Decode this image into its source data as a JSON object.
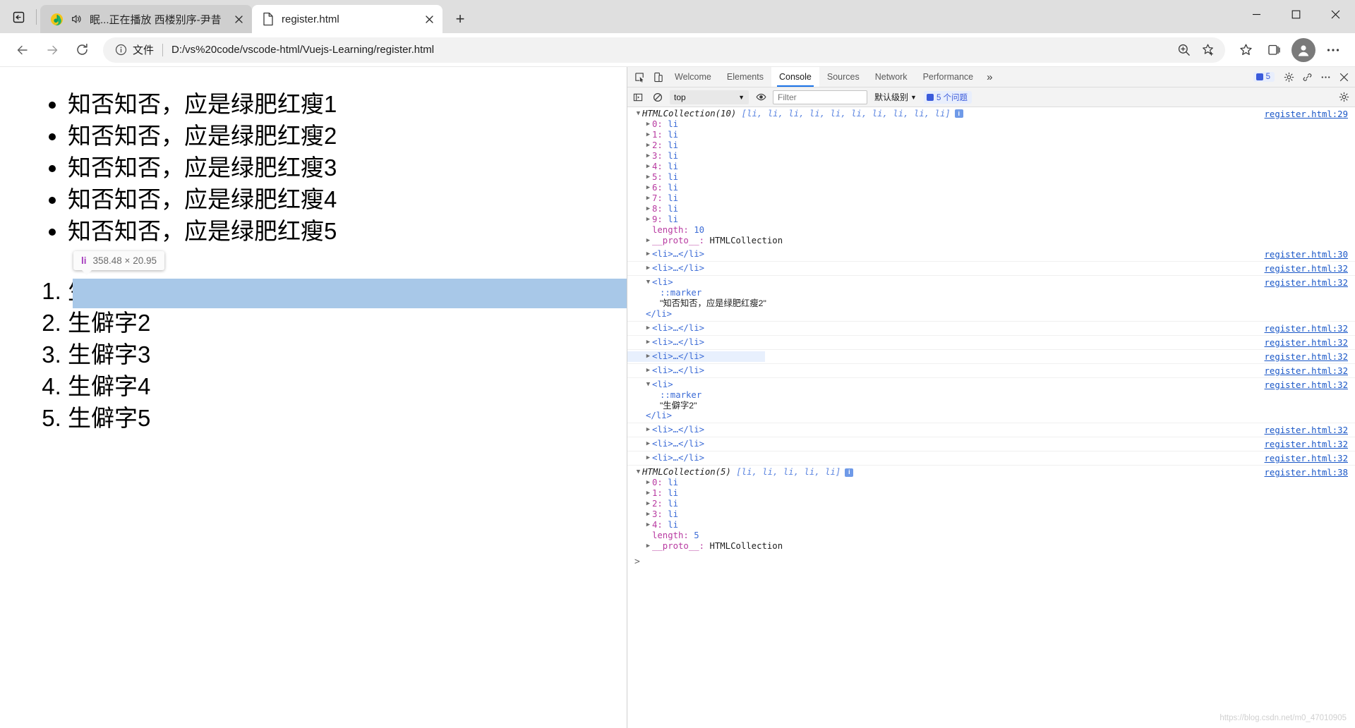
{
  "browser": {
    "tabs": [
      {
        "title": "眠...正在播放 西楼别序-尹昔",
        "favicon": "music-note-icon",
        "active": false
      },
      {
        "title": "register.html",
        "favicon": "document-icon",
        "active": true
      }
    ],
    "newtab_label": "+",
    "window_controls": {
      "minimize": "–",
      "maximize": "▢",
      "close": "✕"
    },
    "omnibox": {
      "scheme_label": "文件",
      "url": "D:/vs%20code/vscode-html/Vuejs-Learning/register.html",
      "info_icon": "info-icon",
      "zoom_icon": "zoom-in-icon",
      "favorite_icon": "star-plus-icon"
    },
    "toolbar": {
      "back": "back-arrow-icon",
      "forward": "forward-arrow-icon",
      "reload": "reload-icon",
      "collections": "collections-icon",
      "favorites": "favorites-icon",
      "profile": "profile-avatar-icon",
      "settings": "more-options-icon"
    }
  },
  "page": {
    "unordered_items": [
      "知否知否，应是绿肥红瘦1",
      "知否知否，应是绿肥红瘦2",
      "知否知否，应是绿肥红瘦3",
      "知否知否，应是绿肥红瘦4",
      "知否知否，应是绿肥红瘦5"
    ],
    "ordered_items": [
      "生僻字1",
      "生僻字2",
      "生僻字3",
      "生僻字4",
      "生僻字5"
    ],
    "inspector_tooltip": {
      "tag": "li",
      "dimensions": "358.48 × 20.95"
    },
    "highlight_color": "#a8c8e8"
  },
  "devtools": {
    "tabs": [
      {
        "label": "Welcome",
        "active": false
      },
      {
        "label": "Elements",
        "active": false
      },
      {
        "label": "Console",
        "active": true
      },
      {
        "label": "Sources",
        "active": false
      },
      {
        "label": "Network",
        "active": false
      },
      {
        "label": "Performance",
        "active": false
      }
    ],
    "more_tabs": "»",
    "issues_badge": "5",
    "icons": {
      "inspect": "inspect-element-icon",
      "device": "device-toolbar-icon",
      "settings": "gear-icon",
      "customize": "more-options-icon",
      "close": "close-icon",
      "sidebar": "console-sidebar-icon",
      "clear": "clear-console-icon",
      "eye": "live-expression-icon",
      "gear": "console-settings-icon"
    },
    "filterbar": {
      "context": "top",
      "filter_placeholder": "Filter",
      "level": "默认级别",
      "issues": "5 个问题"
    },
    "console": {
      "sources": {
        "s29": "register.html:29",
        "s30": "register.html:30",
        "s32": "register.html:32",
        "s38": "register.html:38"
      },
      "group1": {
        "header": "HTMLCollection(10)",
        "preview": "[li, li, li, li, li, li, li, li, li, li]",
        "entries": [
          {
            "index": "0:",
            "value": "li"
          },
          {
            "index": "1:",
            "value": "li"
          },
          {
            "index": "2:",
            "value": "li"
          },
          {
            "index": "3:",
            "value": "li"
          },
          {
            "index": "4:",
            "value": "li"
          },
          {
            "index": "5:",
            "value": "li"
          },
          {
            "index": "6:",
            "value": "li"
          },
          {
            "index": "7:",
            "value": "li"
          },
          {
            "index": "8:",
            "value": "li"
          },
          {
            "index": "9:",
            "value": "li"
          }
        ],
        "length_key": "length:",
        "length_value": "10",
        "proto_key": "__proto__:",
        "proto_value": "HTMLCollection"
      },
      "collapsed_li": "<li>…</li>",
      "expanded_li_1": {
        "open": "<li>",
        "marker": "::marker",
        "text": "\"知否知否，应是绿肥红瘦2\"",
        "close": "</li>"
      },
      "expanded_li_2": {
        "open": "<li>",
        "marker": "::marker",
        "text": "\"生僻字2\"",
        "close": "</li>"
      },
      "group2": {
        "header": "HTMLCollection(5)",
        "preview": "[li, li, li, li, li]",
        "entries": [
          {
            "index": "0:",
            "value": "li"
          },
          {
            "index": "1:",
            "value": "li"
          },
          {
            "index": "2:",
            "value": "li"
          },
          {
            "index": "3:",
            "value": "li"
          },
          {
            "index": "4:",
            "value": "li"
          }
        ],
        "length_key": "length:",
        "length_value": "5",
        "proto_key": "__proto__:",
        "proto_value": "HTMLCollection"
      },
      "prompt": ">",
      "watermark": "https://blog.csdn.net/m0_47010905"
    }
  }
}
